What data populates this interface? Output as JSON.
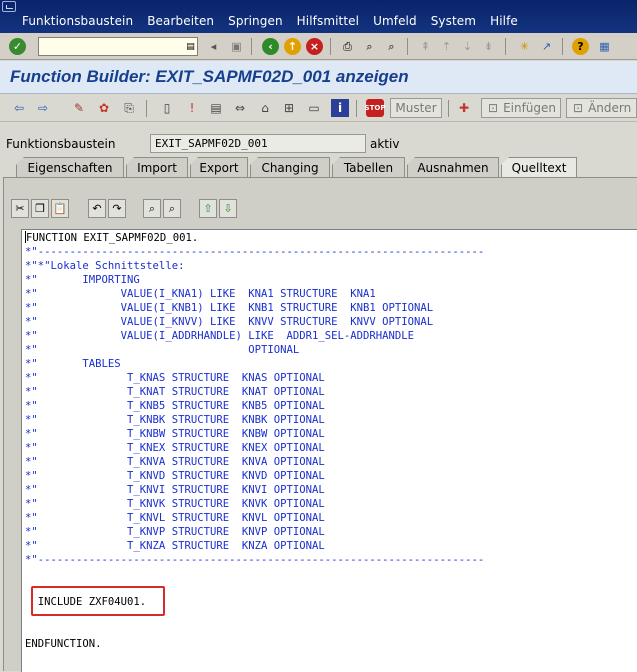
{
  "menubar": {
    "items": [
      "Funktionsbaustein",
      "Bearbeiten",
      "Springen",
      "Hilfsmittel",
      "Umfeld",
      "System",
      "Hilfe"
    ]
  },
  "toolbar1": {
    "command_value": ""
  },
  "title": "Function Builder: EXIT_SAPMF02D_001 anzeigen",
  "toolbar2": {
    "muster_label": "Muster",
    "einfuegen_label": "Einfügen",
    "aendern_label": "Ändern"
  },
  "field": {
    "label": "Funktionsbaustein",
    "value": "EXIT_SAPMF02D_001",
    "status": "aktiv"
  },
  "tabs": [
    "Eigenschaften",
    "Import",
    "Export",
    "Changing",
    "Tabellen",
    "Ausnahmen",
    "Quelltext"
  ],
  "active_tab": "Quelltext",
  "code": {
    "lines": [
      {
        "t": "FUNCTION EXIT_SAPMF02D_001.",
        "k": "k"
      },
      {
        "t": "*\"----------------------------------------------------------------------",
        "k": "c"
      },
      {
        "t": "*\"*\"Lokale Schnittstelle:",
        "k": "c"
      },
      {
        "t": "*\"       IMPORTING",
        "k": "c"
      },
      {
        "t": "*\"             VALUE(I_KNA1) LIKE  KNA1 STRUCTURE  KNA1",
        "k": "c"
      },
      {
        "t": "*\"             VALUE(I_KNB1) LIKE  KNB1 STRUCTURE  KNB1 OPTIONAL",
        "k": "c"
      },
      {
        "t": "*\"             VALUE(I_KNVV) LIKE  KNVV STRUCTURE  KNVV OPTIONAL",
        "k": "c"
      },
      {
        "t": "*\"             VALUE(I_ADDRHANDLE) LIKE  ADDR1_SEL-ADDRHANDLE",
        "k": "c"
      },
      {
        "t": "*\"                                 OPTIONAL",
        "k": "c"
      },
      {
        "t": "*\"       TABLES",
        "k": "c"
      },
      {
        "t": "*\"              T_KNAS STRUCTURE  KNAS OPTIONAL",
        "k": "c"
      },
      {
        "t": "*\"              T_KNAT STRUCTURE  KNAT OPTIONAL",
        "k": "c"
      },
      {
        "t": "*\"              T_KNB5 STRUCTURE  KNB5 OPTIONAL",
        "k": "c"
      },
      {
        "t": "*\"              T_KNBK STRUCTURE  KNBK OPTIONAL",
        "k": "c"
      },
      {
        "t": "*\"              T_KNBW STRUCTURE  KNBW OPTIONAL",
        "k": "c"
      },
      {
        "t": "*\"              T_KNEX STRUCTURE  KNEX OPTIONAL",
        "k": "c"
      },
      {
        "t": "*\"              T_KNVA STRUCTURE  KNVA OPTIONAL",
        "k": "c"
      },
      {
        "t": "*\"              T_KNVD STRUCTURE  KNVD OPTIONAL",
        "k": "c"
      },
      {
        "t": "*\"              T_KNVI STRUCTURE  KNVI OPTIONAL",
        "k": "c"
      },
      {
        "t": "*\"              T_KNVK STRUCTURE  KNVK OPTIONAL",
        "k": "c"
      },
      {
        "t": "*\"              T_KNVL STRUCTURE  KNVL OPTIONAL",
        "k": "c"
      },
      {
        "t": "*\"              T_KNVP STRUCTURE  KNVP OPTIONAL",
        "k": "c"
      },
      {
        "t": "*\"              T_KNZA STRUCTURE  KNZA OPTIONAL",
        "k": "c"
      },
      {
        "t": "*\"----------------------------------------------------------------------",
        "k": "c"
      },
      {
        "t": "",
        "k": "k"
      },
      {
        "t": "",
        "k": "k"
      },
      {
        "t": "  INCLUDE ZXF04U01.",
        "k": "k"
      },
      {
        "t": "",
        "k": "k"
      },
      {
        "t": "",
        "k": "k"
      },
      {
        "t": "ENDFUNCTION.",
        "k": "k"
      }
    ]
  }
}
